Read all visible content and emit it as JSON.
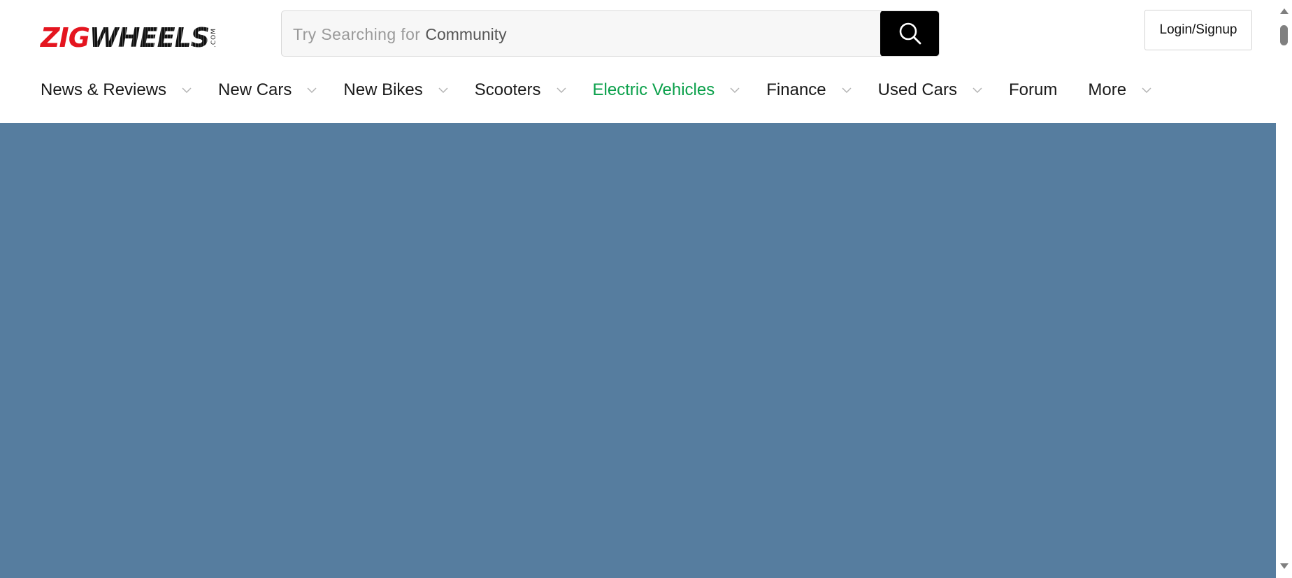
{
  "brand": {
    "logo_part1": "ZIG",
    "logo_part2": "WHEELS",
    "logo_suffix": ".COM",
    "colors": {
      "red": "#e4151f",
      "dark": "#111111"
    }
  },
  "search": {
    "prefix": "Try Searching for",
    "term": "Community",
    "placeholder": "Try Searching for Community",
    "button_icon": "search-icon"
  },
  "header": {
    "login_label": "Login/Signup"
  },
  "nav": {
    "items": [
      {
        "label": "News & Reviews",
        "has_dropdown": true
      },
      {
        "label": "New Cars",
        "has_dropdown": true
      },
      {
        "label": "New Bikes",
        "has_dropdown": true
      },
      {
        "label": "Scooters",
        "has_dropdown": true
      },
      {
        "label": "Electric Vehicles",
        "has_dropdown": true,
        "active": true
      },
      {
        "label": "Finance",
        "has_dropdown": true
      },
      {
        "label": "Used Cars",
        "has_dropdown": true
      },
      {
        "label": "Forum",
        "has_dropdown": false
      },
      {
        "label": "More",
        "has_dropdown": true
      }
    ]
  },
  "colors": {
    "hero_background": "#567d9f",
    "nav_active": "#0aa04a",
    "search_button": "#000000"
  }
}
